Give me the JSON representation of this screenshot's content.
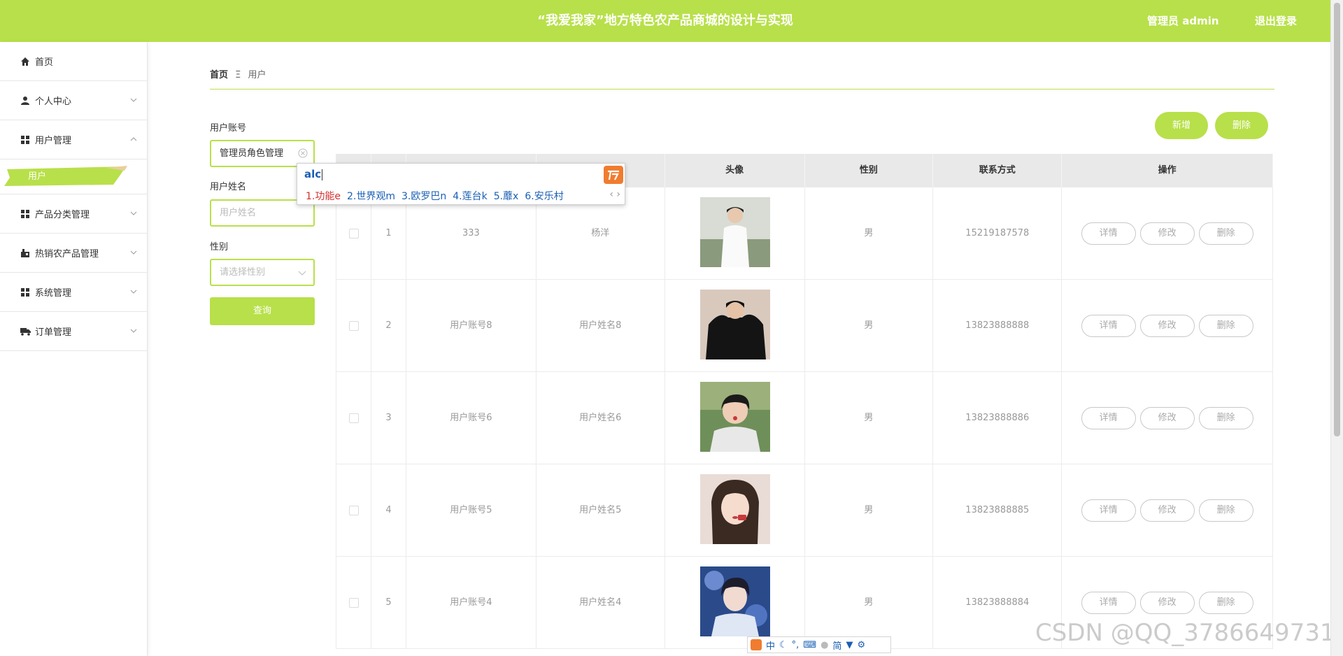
{
  "header": {
    "title": "“我爱我家”地方特色农产品商城的设计与实现",
    "user": "管理员 admin",
    "logout": "退出登录"
  },
  "sidebar": {
    "items": [
      {
        "label": "首页",
        "icon": "home-icon"
      },
      {
        "label": "个人中心",
        "icon": "person-icon"
      },
      {
        "label": "用户管理",
        "icon": "grid-icon",
        "expanded": true,
        "children": [
          {
            "label": "用户",
            "active": true
          }
        ]
      },
      {
        "label": "产品分类管理",
        "icon": "grid-icon"
      },
      {
        "label": "热销农产品管理",
        "icon": "shop-icon"
      },
      {
        "label": "系统管理",
        "icon": "grid-icon"
      },
      {
        "label": "订单管理",
        "icon": "truck-icon"
      }
    ]
  },
  "breadcrumb": {
    "home": "首页",
    "sep": "Ξ",
    "current": "用户"
  },
  "search": {
    "account_label": "用户账号",
    "account_value": "管理员角色管理",
    "name_label": "用户姓名",
    "name_placeholder": "用户姓名",
    "gender_label": "性别",
    "gender_placeholder": "请选择性别",
    "query_button": "查询"
  },
  "ime": {
    "composition": "alc",
    "candidates": [
      "1.功能e",
      "2.世界观m",
      "3.欧罗巴n",
      "4.莲台k",
      "5.蘼x",
      "6.安乐村"
    ],
    "nav": "‹ ›",
    "status_items": [
      "中",
      "简"
    ]
  },
  "actions": {
    "add": "新增",
    "delete": "删除"
  },
  "table": {
    "headers": {
      "avatar": "头像",
      "gender": "性别",
      "phone": "联系方式",
      "ops": "操作"
    },
    "rows": [
      {
        "index": "1",
        "account": "333",
        "name": "杨洋",
        "gender": "男",
        "phone": "15219187578"
      },
      {
        "index": "2",
        "account": "用户账号8",
        "name": "用户姓名8",
        "gender": "男",
        "phone": "13823888888"
      },
      {
        "index": "3",
        "account": "用户账号6",
        "name": "用户姓名6",
        "gender": "男",
        "phone": "13823888886"
      },
      {
        "index": "4",
        "account": "用户账号5",
        "name": "用户姓名5",
        "gender": "男",
        "phone": "13823888885"
      },
      {
        "index": "5",
        "account": "用户账号4",
        "name": "用户姓名4",
        "gender": "男",
        "phone": "13823888884"
      }
    ],
    "ops": {
      "detail": "详情",
      "edit": "修改",
      "delete": "删除"
    }
  },
  "watermark": "CSDN @QQ_3786649731",
  "colors": {
    "accent": "#b8e04a",
    "ime_logo": "#f07c2f"
  }
}
